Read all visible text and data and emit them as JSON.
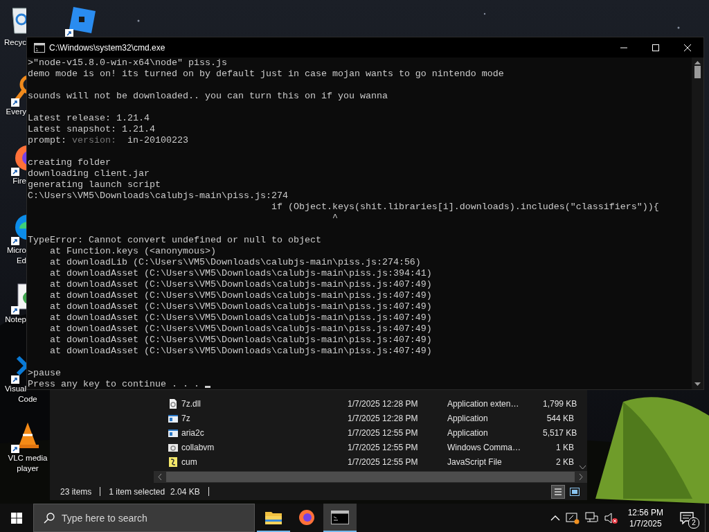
{
  "desktop": {
    "columns": [
      [
        {
          "kind": "recycle-bin",
          "shortcut": false,
          "label": [
            "Recyc"
          ]
        },
        {
          "kind": "magnifier",
          "shortcut": true,
          "label": [
            "Every"
          ]
        },
        {
          "kind": "firefox",
          "shortcut": true,
          "label": [
            "Fire"
          ]
        },
        {
          "kind": "edge",
          "shortcut": true,
          "label": [
            "Micro",
            "Ed"
          ]
        },
        {
          "kind": "notepad",
          "shortcut": true,
          "label": [
            "Notep"
          ]
        },
        {
          "kind": "vscode",
          "shortcut": true,
          "label": [
            "Visual",
            "Code"
          ]
        },
        {
          "kind": "vlc",
          "shortcut": true,
          "label": [
            "VLC media",
            "player"
          ]
        }
      ],
      [
        {
          "kind": "tiles",
          "shortcut": true
        }
      ]
    ]
  },
  "cmd_window": {
    "title": "C:\\Windows\\system32\\cmd.exe",
    "lines": [
      {
        "kind": "text",
        "text": ">\"node-v15.8.0-win-x64\\node\" piss.js"
      },
      {
        "kind": "text",
        "text": "demo mode is on! its turned on by default just in case mojan wants to go nintendo mode"
      },
      {
        "kind": "blank"
      },
      {
        "kind": "text",
        "text": "sounds will not be downloaded.. you can turn this on if you wanna"
      },
      {
        "kind": "blank"
      },
      {
        "kind": "text",
        "text": "Latest release: 1.21.4"
      },
      {
        "kind": "text",
        "text": "Latest snapshot: 1.21.4"
      },
      {
        "kind": "prompt",
        "label": "prompt:",
        "hint": "version:",
        "value": "in-20100223"
      },
      {
        "kind": "blank"
      },
      {
        "kind": "text",
        "text": "creating folder"
      },
      {
        "kind": "text",
        "text": "downloading client.jar"
      },
      {
        "kind": "text",
        "text": "generating launch script"
      },
      {
        "kind": "text",
        "text": "C:\\Users\\VM5\\Downloads\\calubjs-main\\piss.js:274"
      },
      {
        "kind": "text",
        "text": "                                            if (Object.keys(shit.libraries[i].downloads).includes(\"classifiers\")){"
      },
      {
        "kind": "text",
        "text": "                                                       ^"
      },
      {
        "kind": "blank"
      },
      {
        "kind": "text",
        "text": "TypeError: Cannot convert undefined or null to object"
      },
      {
        "kind": "text",
        "text": "    at Function.keys (<anonymous>)"
      },
      {
        "kind": "text",
        "text": "    at downloadLib (C:\\Users\\VM5\\Downloads\\calubjs-main\\piss.js:274:56)"
      },
      {
        "kind": "text",
        "text": "    at downloadAsset (C:\\Users\\VM5\\Downloads\\calubjs-main\\piss.js:394:41)"
      },
      {
        "kind": "text",
        "text": "    at downloadAsset (C:\\Users\\VM5\\Downloads\\calubjs-main\\piss.js:407:49)"
      },
      {
        "kind": "text",
        "text": "    at downloadAsset (C:\\Users\\VM5\\Downloads\\calubjs-main\\piss.js:407:49)"
      },
      {
        "kind": "text",
        "text": "    at downloadAsset (C:\\Users\\VM5\\Downloads\\calubjs-main\\piss.js:407:49)"
      },
      {
        "kind": "text",
        "text": "    at downloadAsset (C:\\Users\\VM5\\Downloads\\calubjs-main\\piss.js:407:49)"
      },
      {
        "kind": "text",
        "text": "    at downloadAsset (C:\\Users\\VM5\\Downloads\\calubjs-main\\piss.js:407:49)"
      },
      {
        "kind": "text",
        "text": "    at downloadAsset (C:\\Users\\VM5\\Downloads\\calubjs-main\\piss.js:407:49)"
      },
      {
        "kind": "text",
        "text": "    at downloadAsset (C:\\Users\\VM5\\Downloads\\calubjs-main\\piss.js:407:49)"
      },
      {
        "kind": "blank"
      },
      {
        "kind": "text",
        "text": ">pause"
      },
      {
        "kind": "waiting",
        "text": "Press any key to continue . . ."
      }
    ]
  },
  "explorer": {
    "rows": [
      {
        "kind": "dll",
        "name": "7z.dll",
        "modified": "1/7/2025 12:28 PM",
        "type": "Application exten…",
        "size": "1,799 KB"
      },
      {
        "kind": "app",
        "name": "7z",
        "modified": "1/7/2025 12:28 PM",
        "type": "Application",
        "size": "544 KB"
      },
      {
        "kind": "app",
        "name": "aria2c",
        "modified": "1/7/2025 12:55 PM",
        "type": "Application",
        "size": "5,517 KB"
      },
      {
        "kind": "batch",
        "name": "collabvm",
        "modified": "1/7/2025 12:55 PM",
        "type": "Windows Comma…",
        "size": "1 KB"
      },
      {
        "kind": "script",
        "name": "cum",
        "modified": "1/7/2025 12:55 PM",
        "type": "JavaScript File",
        "size": "2 KB"
      }
    ],
    "status": {
      "count": "23 items",
      "selection": "1 item selected",
      "selection_size": "2.04 KB"
    },
    "views": [
      {
        "kind": "details",
        "selected": true
      },
      {
        "kind": "large-icons",
        "selected": false
      }
    ]
  },
  "taskbar": {
    "search": {
      "placeholder": "Type here to search"
    },
    "apps": [
      {
        "kind": "explorer",
        "running": true,
        "selected": false
      },
      {
        "kind": "firefox",
        "running": false,
        "selected": false
      },
      {
        "kind": "terminal",
        "running": true,
        "selected": true
      }
    ],
    "tray": {
      "time": "12:56 PM",
      "date": "1/7/2025",
      "notification_count": "2"
    }
  }
}
